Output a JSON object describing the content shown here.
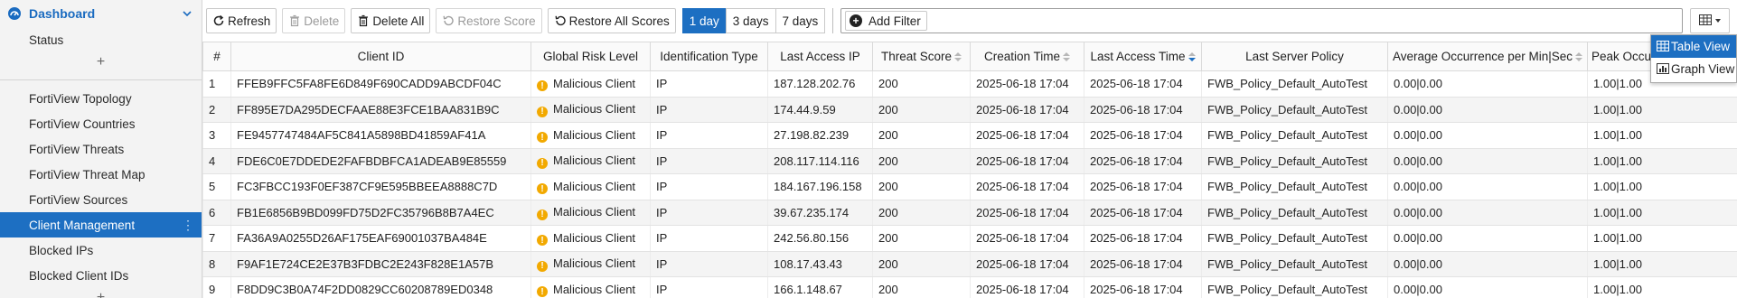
{
  "sidebar": {
    "header": "Dashboard",
    "status_item": "Status",
    "plus": "+",
    "items": [
      {
        "label": "FortiView Topology"
      },
      {
        "label": "FortiView Countries"
      },
      {
        "label": "FortiView Threats"
      },
      {
        "label": "FortiView Threat Map"
      },
      {
        "label": "FortiView Sources"
      },
      {
        "label": "Client Management",
        "active": true
      },
      {
        "label": "Blocked IPs"
      },
      {
        "label": "Blocked Client IDs"
      }
    ]
  },
  "toolbar": {
    "refresh": "Refresh",
    "delete": "Delete",
    "delete_all": "Delete All",
    "restore_score": "Restore Score",
    "restore_all_scores": "Restore All Scores",
    "ranges": [
      "1 day",
      "3 days",
      "7 days"
    ],
    "active_range": "1 day",
    "add_filter": "Add Filter"
  },
  "view_menu": {
    "table_view": "Table View",
    "graph_view": "Graph View",
    "active": "Table View"
  },
  "table": {
    "columns": [
      "#",
      "Client ID",
      "Global Risk Level",
      "Identification Type",
      "Last Access IP",
      "Threat Score",
      "Creation Time",
      "Last Access Time",
      "Last Server Policy",
      "Average Occurrence per Min|Sec",
      "Peak Occurre"
    ],
    "rows": [
      {
        "n": "1",
        "client_id": "FFEB9FFC5FA8FE6D849F690CADD9ABCDF04C",
        "risk": "Malicious Client",
        "id_type": "IP",
        "ip": "187.128.202.76",
        "score": "200",
        "created": "2025-06-18 17:04",
        "last_access": "2025-06-18 17:04",
        "policy": "FWB_Policy_Default_AutoTest",
        "avg": "0.00|0.00",
        "peak": "1.00|1.00"
      },
      {
        "n": "2",
        "client_id": "FF895E7DA295DECFAAE88E3FCE1BAA831B9C",
        "risk": "Malicious Client",
        "id_type": "IP",
        "ip": "174.44.9.59",
        "score": "200",
        "created": "2025-06-18 17:04",
        "last_access": "2025-06-18 17:04",
        "policy": "FWB_Policy_Default_AutoTest",
        "avg": "0.00|0.00",
        "peak": "1.00|1.00"
      },
      {
        "n": "3",
        "client_id": "FE9457747484AF5C841A5898BD41859AF41A",
        "risk": "Malicious Client",
        "id_type": "IP",
        "ip": "27.198.82.239",
        "score": "200",
        "created": "2025-06-18 17:04",
        "last_access": "2025-06-18 17:04",
        "policy": "FWB_Policy_Default_AutoTest",
        "avg": "0.00|0.00",
        "peak": "1.00|1.00"
      },
      {
        "n": "4",
        "client_id": "FDE6C0E7DDEDE2FAFBDBFCA1ADEAB9E85559",
        "risk": "Malicious Client",
        "id_type": "IP",
        "ip": "208.117.114.116",
        "score": "200",
        "created": "2025-06-18 17:04",
        "last_access": "2025-06-18 17:04",
        "policy": "FWB_Policy_Default_AutoTest",
        "avg": "0.00|0.00",
        "peak": "1.00|1.00"
      },
      {
        "n": "5",
        "client_id": "FC3FBCC193F0EF387CF9E595BBEEA8888C7D",
        "risk": "Malicious Client",
        "id_type": "IP",
        "ip": "184.167.196.158",
        "score": "200",
        "created": "2025-06-18 17:04",
        "last_access": "2025-06-18 17:04",
        "policy": "FWB_Policy_Default_AutoTest",
        "avg": "0.00|0.00",
        "peak": "1.00|1.00"
      },
      {
        "n": "6",
        "client_id": "FB1E6856B9BD099FD75D2FC35796B8B7A4EC",
        "risk": "Malicious Client",
        "id_type": "IP",
        "ip": "39.67.235.174",
        "score": "200",
        "created": "2025-06-18 17:04",
        "last_access": "2025-06-18 17:04",
        "policy": "FWB_Policy_Default_AutoTest",
        "avg": "0.00|0.00",
        "peak": "1.00|1.00"
      },
      {
        "n": "7",
        "client_id": "FA36A9A0255D26AF175EAF69001037BA484E",
        "risk": "Malicious Client",
        "id_type": "IP",
        "ip": "242.56.80.156",
        "score": "200",
        "created": "2025-06-18 17:04",
        "last_access": "2025-06-18 17:04",
        "policy": "FWB_Policy_Default_AutoTest",
        "avg": "0.00|0.00",
        "peak": "1.00|1.00"
      },
      {
        "n": "8",
        "client_id": "F9AF1E724CE2E37B3FDBC2E243F828E1A57B",
        "risk": "Malicious Client",
        "id_type": "IP",
        "ip": "108.17.43.43",
        "score": "200",
        "created": "2025-06-18 17:04",
        "last_access": "2025-06-18 17:04",
        "policy": "FWB_Policy_Default_AutoTest",
        "avg": "0.00|0.00",
        "peak": "1.00|1.00"
      },
      {
        "n": "9",
        "client_id": "F8DD9C3B0A74F2DD0829CC60208789ED0348",
        "risk": "Malicious Client",
        "id_type": "IP",
        "ip": "166.1.148.67",
        "score": "200",
        "created": "2025-06-18 17:04",
        "last_access": "2025-06-18 17:04",
        "policy": "FWB_Policy_Default_AutoTest",
        "avg": "0.00|0.00",
        "peak": "1.00|1.00"
      }
    ]
  },
  "colors": {
    "accent": "#1d6fc2",
    "risk_icon": "#f2a900"
  }
}
